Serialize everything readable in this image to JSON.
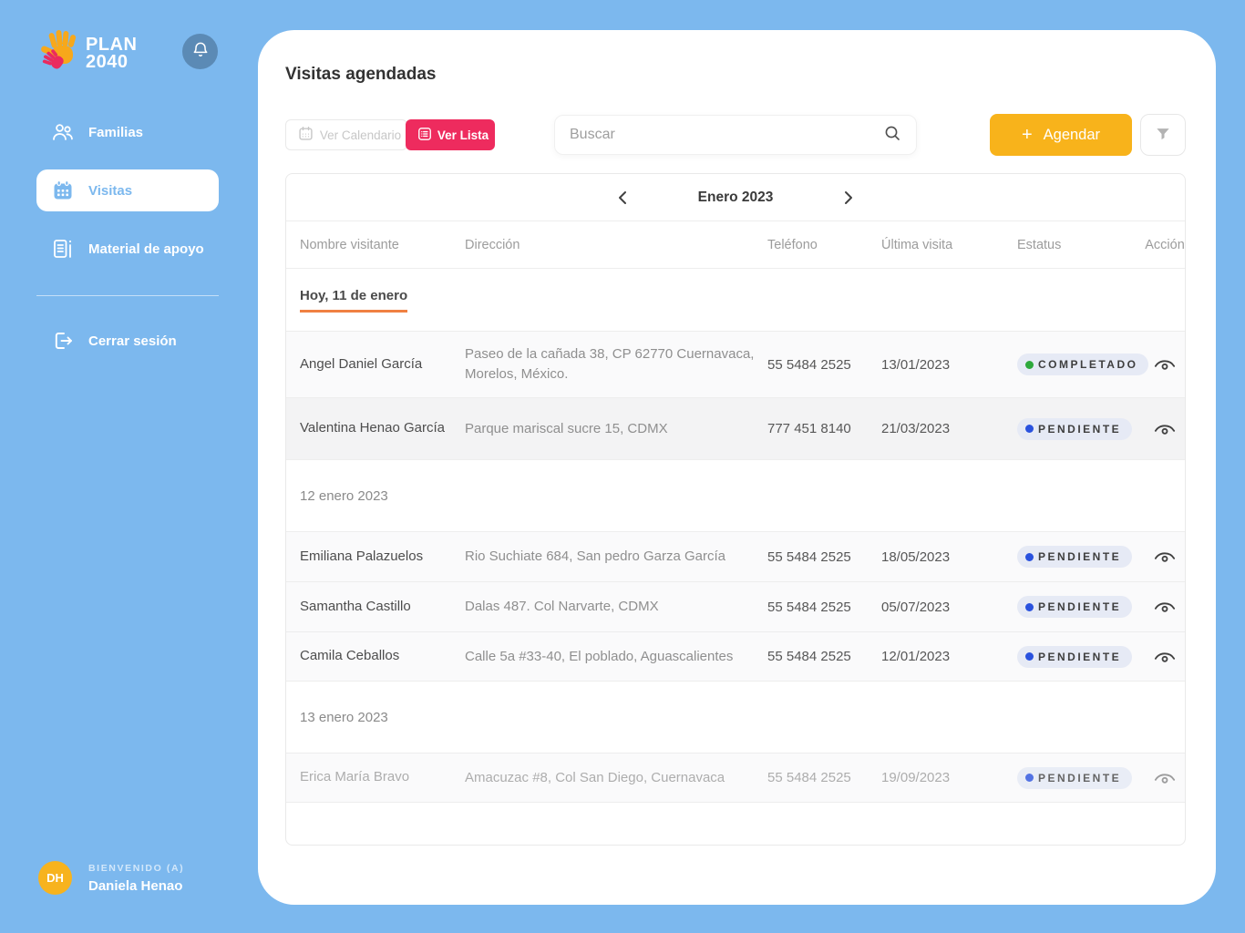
{
  "brand": {
    "line1": "PLAN",
    "line2": "2040"
  },
  "sidebar": {
    "items": [
      {
        "label": "Familias"
      },
      {
        "label": "Visitas"
      },
      {
        "label": "Material de apoyo"
      }
    ],
    "logout_label": "Cerrar sesión",
    "welcome_label": "BIENVENIDO (A)",
    "user_name": "Daniela Henao",
    "user_initials": "DH"
  },
  "header": {
    "title": "Visitas agendadas"
  },
  "toolbar": {
    "view_calendar_label": "Ver Calendario",
    "view_list_label": "Ver Lista",
    "search_placeholder": "Buscar",
    "schedule_plus": "+",
    "schedule_label": "Agendar"
  },
  "calendar_nav": {
    "month_label": "Enero 2023"
  },
  "table": {
    "columns": [
      "Nombre visitante",
      "Dirección",
      "Teléfono",
      "Última visita",
      "Estatus",
      "Acción"
    ],
    "groups": [
      {
        "label": "Hoy, 11 de enero",
        "rows": [
          {
            "name": "Angel Daniel García",
            "address": "Paseo de la cañada 38, CP 62770 Cuernavaca, Morelos, México.",
            "phone": "55 5484 2525",
            "last_visit": "13/01/2023",
            "status": "COMPLETADO",
            "status_type": "completed"
          },
          {
            "name": "Valentina Henao García",
            "address": "Parque mariscal sucre 15, CDMX",
            "phone": "777 451 8140",
            "last_visit": "21/03/2023",
            "status": "PENDIENTE",
            "status_type": "pending"
          }
        ]
      },
      {
        "label": "12 enero 2023",
        "rows": [
          {
            "name": "Emiliana Palazuelos",
            "address": "Rio Suchiate 684, San pedro Garza García",
            "phone": "55 5484 2525",
            "last_visit": "18/05/2023",
            "status": "PENDIENTE",
            "status_type": "pending"
          },
          {
            "name": "Samantha Castillo",
            "address": "Dalas 487. Col Narvarte, CDMX",
            "phone": "55 5484 2525",
            "last_visit": "05/07/2023",
            "status": "PENDIENTE",
            "status_type": "pending"
          },
          {
            "name": "Camila Ceballos",
            "address": "Calle 5a #33-40, El poblado, Aguascalientes",
            "phone": "55 5484 2525",
            "last_visit": "12/01/2023",
            "status": "PENDIENTE",
            "status_type": "pending"
          }
        ]
      },
      {
        "label": "13 enero 2023",
        "rows": [
          {
            "name": "Erica María Bravo",
            "address": "Amacuzac #8, Col San Diego, Cuernavaca",
            "phone": "55 5484 2525",
            "last_visit": "19/09/2023",
            "status": "PENDIENTE",
            "status_type": "pending"
          }
        ]
      }
    ]
  },
  "colors": {
    "sidebar_bg": "#7CB8EE",
    "accent_pink": "#EE2B5E",
    "accent_yellow": "#F8B31B",
    "logo_yellow": "#F7A81B",
    "logo_pink": "#EA2A5F",
    "status_completed_dot": "#2EA93C",
    "status_pending_dot": "#2A52DE",
    "badge_bg": "#E6EAF5",
    "group_underline": "#F08142"
  }
}
